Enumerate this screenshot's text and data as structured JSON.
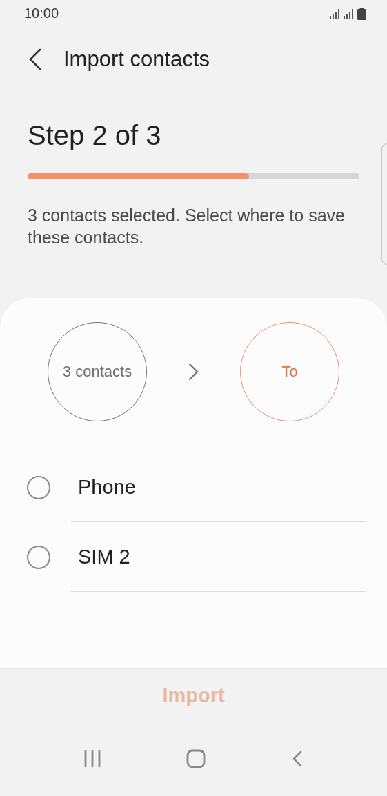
{
  "status_bar": {
    "time": "10:00"
  },
  "header": {
    "title": "Import contacts"
  },
  "step": {
    "title": "Step 2 of 3",
    "level": 0.667
  },
  "description": "3 contacts selected. Select where to save these contacts.",
  "flow": {
    "source": "3 contacts",
    "target": "To"
  },
  "options": [
    {
      "label": "Phone",
      "selected": false
    },
    {
      "label": "SIM 2",
      "selected": false
    }
  ],
  "action": {
    "label": "Import",
    "disabled": true
  }
}
